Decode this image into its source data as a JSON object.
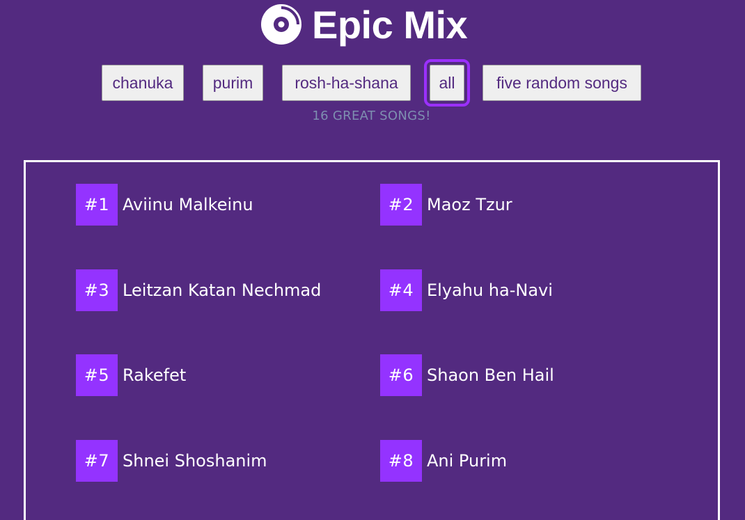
{
  "header": {
    "title": "Epic Mix",
    "logo_icon": "vinyl-disc-icon"
  },
  "filters": {
    "items": [
      {
        "label": "chanuka",
        "active": false
      },
      {
        "label": "purim",
        "active": false
      },
      {
        "label": "rosh-ha-shana",
        "active": false
      },
      {
        "label": "all",
        "active": true
      },
      {
        "label": "five random songs",
        "active": false
      }
    ]
  },
  "summary": {
    "count_text": "16 great songs!"
  },
  "songs": [
    {
      "rank": "#1",
      "title": "Aviinu Malkeinu"
    },
    {
      "rank": "#2",
      "title": "Maoz Tzur"
    },
    {
      "rank": "#3",
      "title": "Leitzan Katan Nechmad"
    },
    {
      "rank": "#4",
      "title": "Elyahu ha-Navi"
    },
    {
      "rank": "#5",
      "title": "Rakefet"
    },
    {
      "rank": "#6",
      "title": "Shaon Ben Hail"
    },
    {
      "rank": "#7",
      "title": "Shnei Shoshanim"
    },
    {
      "rank": "#8",
      "title": "Ani Purim"
    }
  ],
  "colors": {
    "background": "#532a80",
    "accent": "#9433ff",
    "button_text": "#532a80",
    "muted_text": "#7e8fb0"
  }
}
